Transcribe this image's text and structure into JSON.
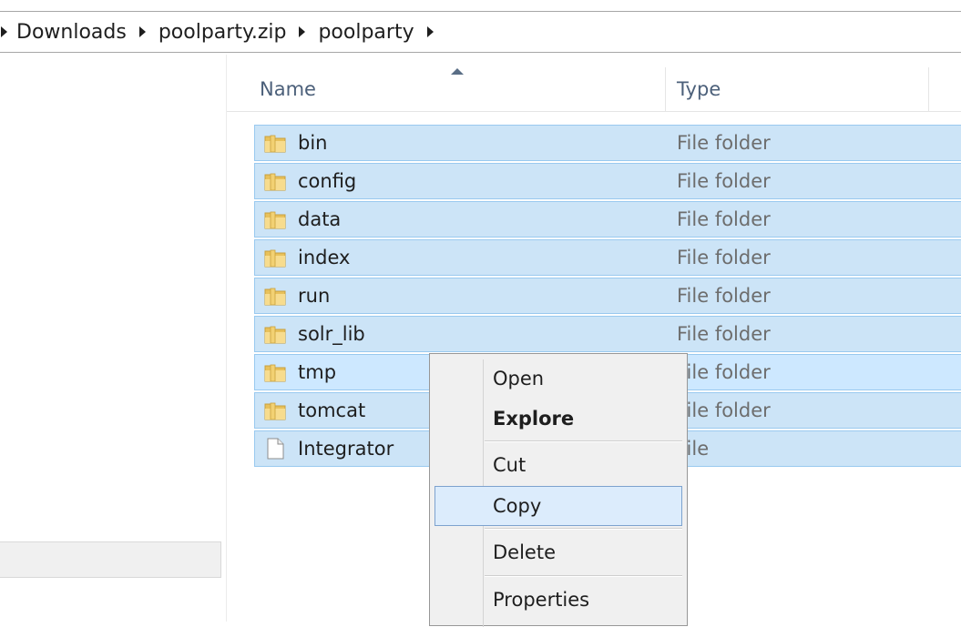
{
  "breadcrumb": [
    "Downloads",
    "poolparty.zip",
    "poolparty"
  ],
  "columns": {
    "name": "Name",
    "type": "Type"
  },
  "files": [
    {
      "name": "bin",
      "type": "File folder",
      "icon": "folder-icon"
    },
    {
      "name": "config",
      "type": "File folder",
      "icon": "folder-icon"
    },
    {
      "name": "data",
      "type": "File folder",
      "icon": "folder-icon"
    },
    {
      "name": "index",
      "type": "File folder",
      "icon": "folder-icon"
    },
    {
      "name": "run",
      "type": "File folder",
      "icon": "folder-icon"
    },
    {
      "name": "solr_lib",
      "type": "File folder",
      "icon": "folder-icon"
    },
    {
      "name": "tmp",
      "type": "File folder",
      "icon": "folder-icon"
    },
    {
      "name": "tomcat",
      "type": "File folder",
      "icon": "folder-icon"
    },
    {
      "name": "Integrator",
      "type": "File",
      "icon": "file-icon"
    }
  ],
  "context_menu": {
    "open": "Open",
    "explore": "Explore",
    "cut": "Cut",
    "copy": "Copy",
    "delete": "Delete",
    "properties": "Properties"
  },
  "colors": {
    "selection": "#cce4f7",
    "selection_border": "#99c9ef",
    "menu_bg": "#f0f0f0",
    "menu_hover": "#dcecfc"
  }
}
